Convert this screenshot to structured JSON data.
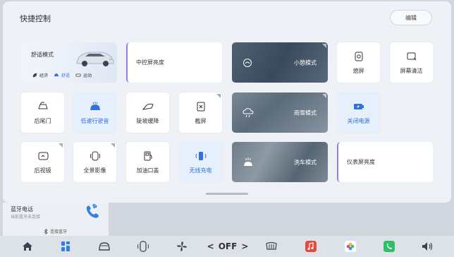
{
  "header": {
    "title": "快捷控制",
    "edit_label": "编辑"
  },
  "comfort": {
    "title": "舒适模式",
    "options": [
      {
        "label": "经济",
        "icon": "leaf-icon"
      },
      {
        "label": "舒适",
        "icon": "car-icon",
        "selected": true
      },
      {
        "label": "运动",
        "icon": "sport-icon"
      }
    ]
  },
  "tiles": {
    "center_brightness": "中控屏亮度",
    "nap_mode": "小憩模式",
    "screen_off": "熄屏",
    "screen_clean": "屏幕清洁",
    "tailgate": "后尾门",
    "low_speed_sound": "低速行驶音",
    "hill_descent": "陡坡缓降",
    "screenshot": "截屏",
    "rain_snow_mode": "雨雪模式",
    "power_off": "关闭电源",
    "rearview_mirror": "后视镜",
    "panoramic_view": "全景影像",
    "fuel_cap": "加油口盖",
    "wireless_charging": "无线充电",
    "car_wash_mode": "洗车模式",
    "dashboard_brightness": "仪表屏亮度"
  },
  "bluetooth": {
    "title": "蓝牙电话",
    "subtitle": "当前蓝牙未连接",
    "connect_label": "连接蓝牙"
  },
  "dock": {
    "ac_state": "OFF",
    "left_arrow": "<",
    "right_arrow": ">"
  },
  "colors": {
    "accent": "#3370e0",
    "purple_bar": "#8a7ff2",
    "red_app": "#e24b3b",
    "green_app": "#2fbf6a"
  }
}
